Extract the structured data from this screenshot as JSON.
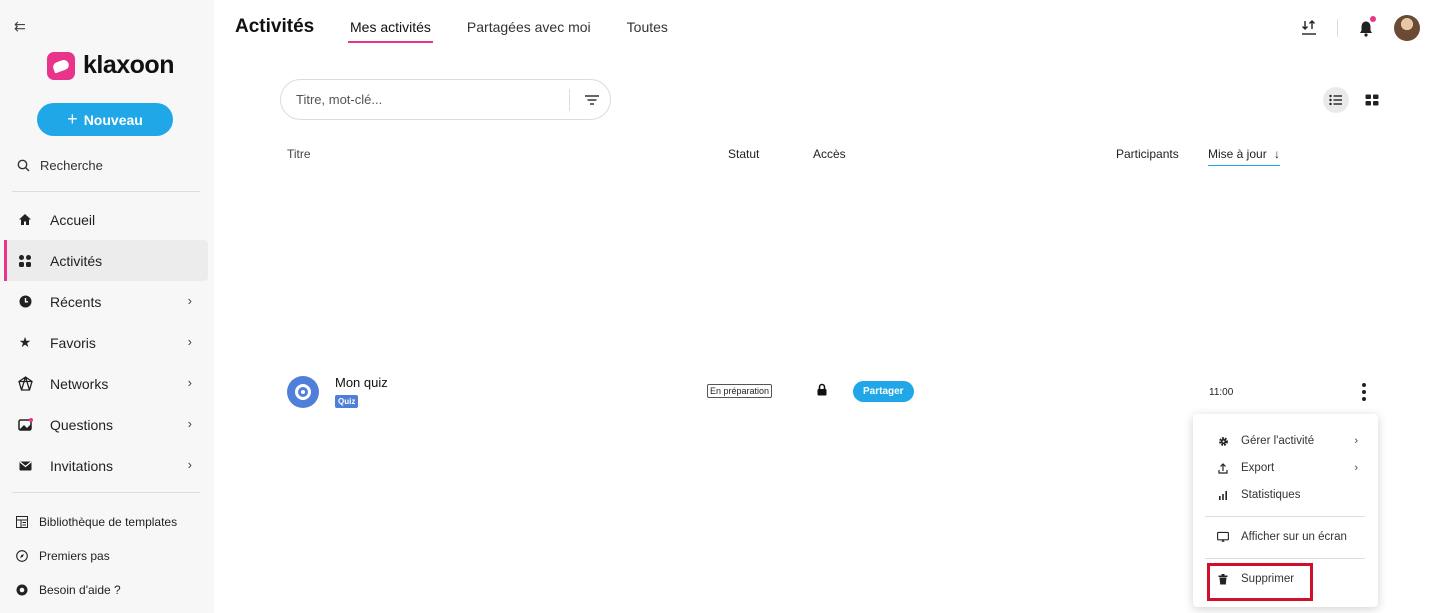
{
  "sidebar": {
    "brand": "klaxoon",
    "new_button": "Nouveau",
    "search_label": "Recherche",
    "nav": [
      {
        "label": "Accueil",
        "icon": "home-icon",
        "has_children": false,
        "active": false
      },
      {
        "label": "Activités",
        "icon": "grid-icon",
        "has_children": false,
        "active": true
      },
      {
        "label": "Récents",
        "icon": "clock-icon",
        "has_children": true,
        "active": false
      },
      {
        "label": "Favoris",
        "icon": "star-icon",
        "has_children": true,
        "active": false
      },
      {
        "label": "Networks",
        "icon": "network-icon",
        "has_children": true,
        "active": false
      },
      {
        "label": "Questions",
        "icon": "question-box-icon",
        "has_children": true,
        "active": false
      },
      {
        "label": "Invitations",
        "icon": "envelope-icon",
        "has_children": true,
        "active": false
      }
    ],
    "bottom_links": [
      {
        "label": "Bibliothèque de templates",
        "icon": "template-icon"
      },
      {
        "label": "Premiers pas",
        "icon": "compass-icon"
      },
      {
        "label": "Besoin d'aide ?",
        "icon": "help-icon"
      }
    ]
  },
  "header": {
    "title": "Activités",
    "tabs": [
      {
        "label": "Mes activités",
        "active": true
      },
      {
        "label": "Partagées avec moi",
        "active": false
      },
      {
        "label": "Toutes",
        "active": false
      }
    ]
  },
  "search": {
    "placeholder": "Titre, mot-clé..."
  },
  "table": {
    "columns": {
      "title": "Titre",
      "status": "Statut",
      "access": "Accès",
      "participants": "Participants",
      "updated": "Mise à jour"
    },
    "rows": [
      {
        "name": "Mon quiz",
        "type": "Quiz",
        "status": "En préparation",
        "share_label": "Partager",
        "updated": "11:00"
      }
    ]
  },
  "context_menu": {
    "items": [
      {
        "label": "Gérer l'activité",
        "icon": "gear-icon",
        "has_submenu": true
      },
      {
        "label": "Export",
        "icon": "export-icon",
        "has_submenu": true
      },
      {
        "label": "Statistiques",
        "icon": "stats-icon",
        "has_submenu": false
      },
      {
        "label": "Afficher sur un écran",
        "icon": "screen-icon",
        "has_submenu": false
      },
      {
        "label": "Supprimer",
        "icon": "trash-icon",
        "has_submenu": false
      }
    ]
  },
  "colors": {
    "accent_pink": "#e8358b",
    "accent_blue": "#1fa7e8",
    "quiz_blue": "#4f7fd8",
    "highlight_red": "#d0102b"
  }
}
